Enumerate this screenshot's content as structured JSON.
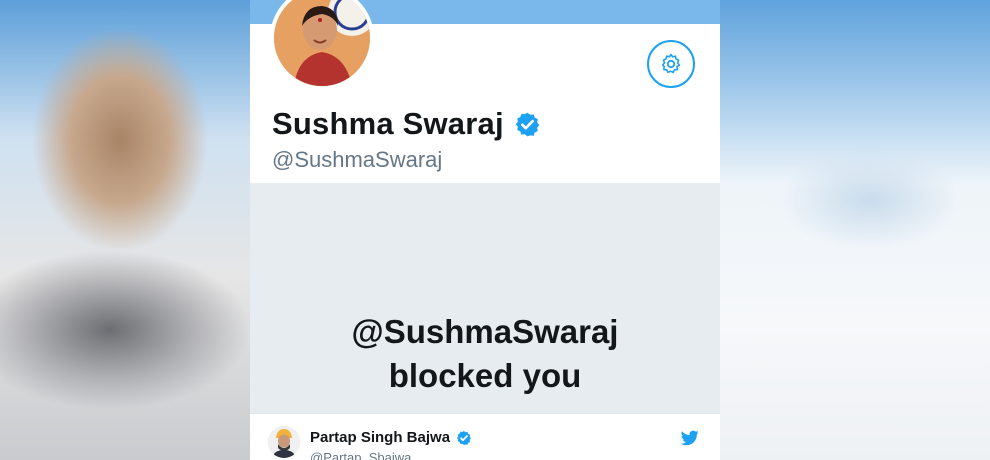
{
  "profile": {
    "name": "Sushma Swaraj",
    "handle": "@SushmaSwaraj"
  },
  "icons": {
    "settings": "gear-icon",
    "verified": "verified-badge-icon",
    "twitter": "twitter-bird-icon"
  },
  "blocked_message": {
    "line1": "@SushmaSwaraj",
    "line2": "blocked you"
  },
  "tweet_author": {
    "name": "Partap Singh Bajwa",
    "handle": "@Partap_Sbajwa"
  },
  "colors": {
    "accent": "#1da1f2",
    "banner": "#7ab8eb",
    "panel": "#e6ecf0",
    "text": "#14171a",
    "muted": "#657786"
  }
}
